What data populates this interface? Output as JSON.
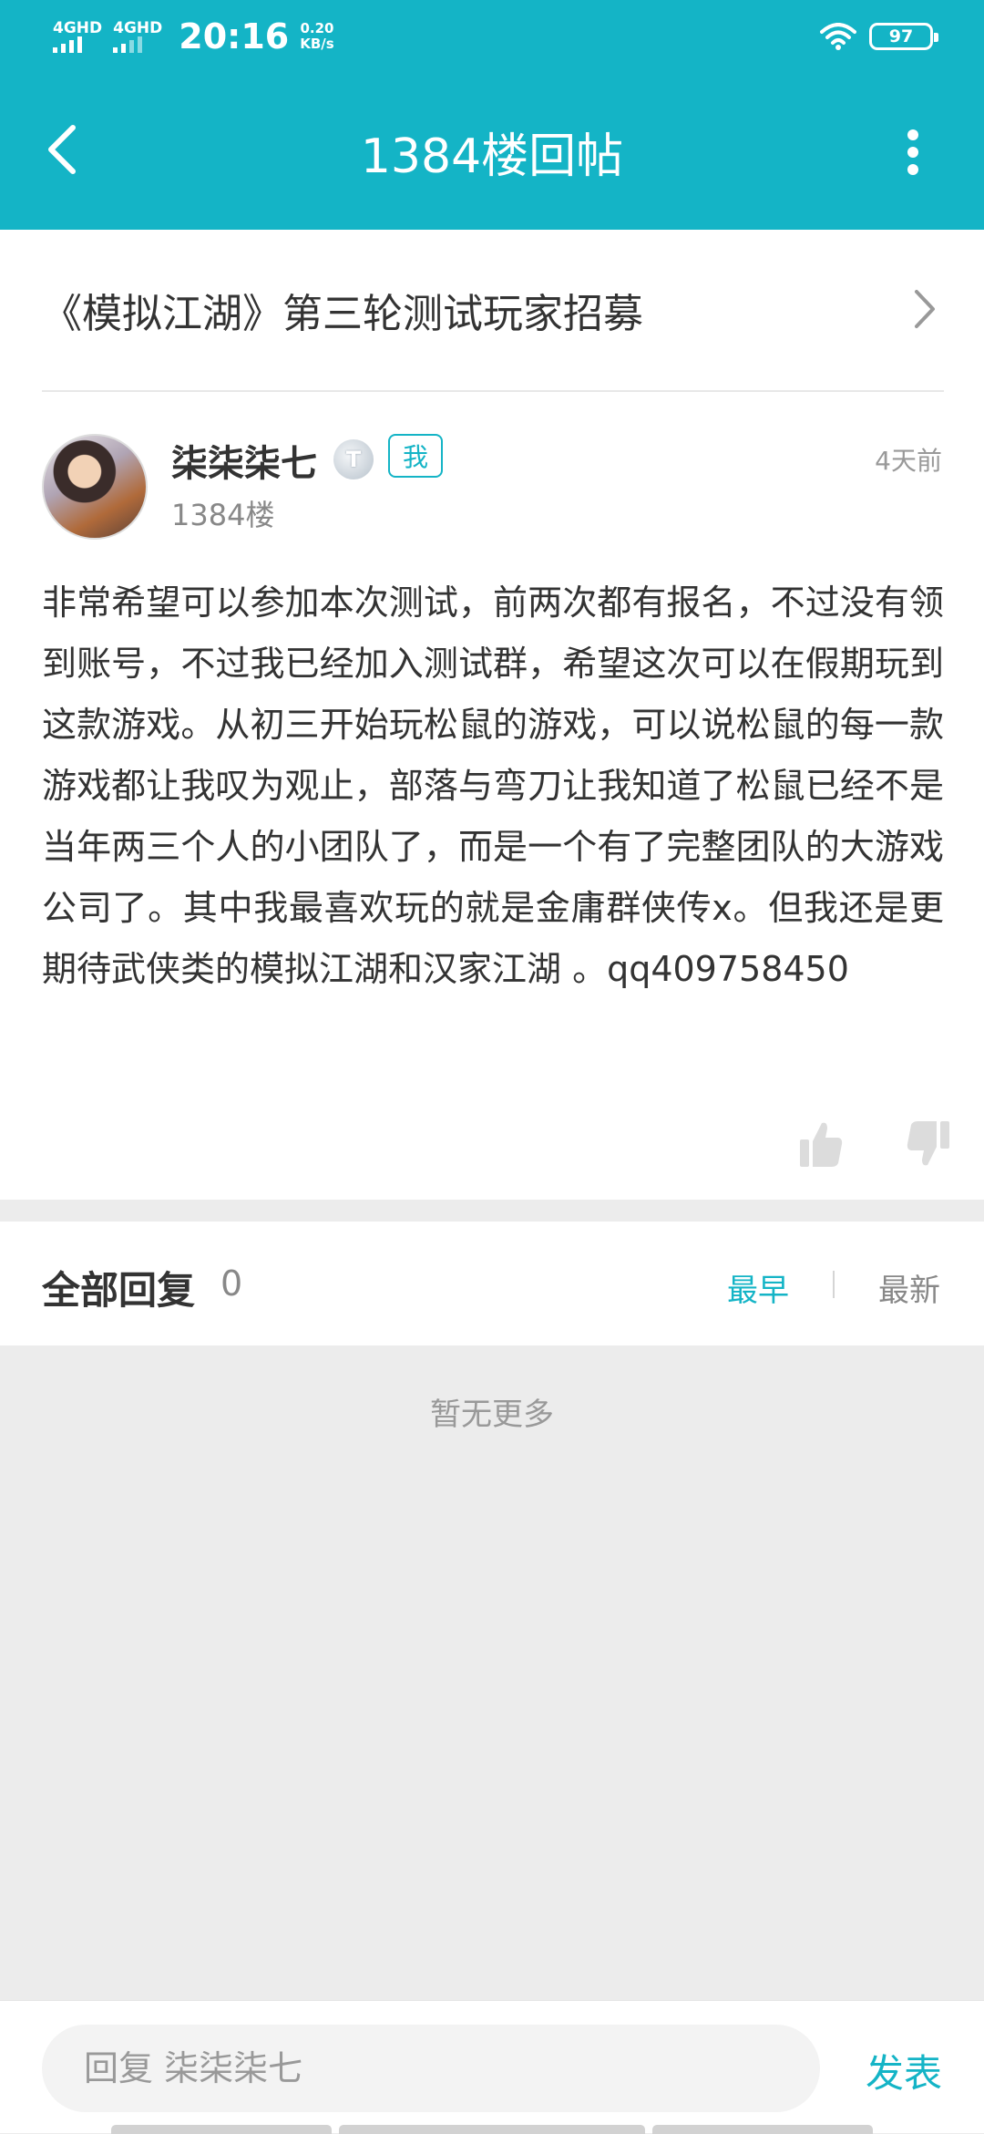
{
  "status_bar": {
    "network_1": "4GHD",
    "network_2": "4GHD",
    "time": "20:16",
    "speed_value": "0.20",
    "speed_unit": "KB/s",
    "battery": "97"
  },
  "header": {
    "title": "1384楼回帖"
  },
  "topic": {
    "title": "《模拟江湖》第三轮测试玩家招募"
  },
  "post": {
    "author": "柒柒柒七",
    "level_badge": "T",
    "me_tag": "我",
    "time": "4天前",
    "floor": "1384楼",
    "content": " 非常希望可以参加本次测试，前两次都有报名，不过没有领到账号，不过我已经加入测试群，希望这次可以在假期玩到这款游戏。从初三开始玩松鼠的游戏，可以说松鼠的每一款游戏都让我叹为观止，部落与弯刀让我知道了松鼠已经不是当年两三个人的小团队了，而是一个有了完整团队的大游戏公司了。其中我最喜欢玩的就是金庸群侠传x。但我还是更期待武侠类的模拟江湖和汉家江湖 。qq409758450"
  },
  "replies": {
    "title": "全部回复",
    "count": "0",
    "sort_earliest": "最早",
    "sort_newest": "最新",
    "empty_text": "暂无更多"
  },
  "reply_bar": {
    "placeholder": "回复 柒柒柒七",
    "send_label": "发表"
  },
  "colors": {
    "accent": "#14b4c6",
    "background": "#ececec"
  },
  "icons": {
    "back": "chevron-left-icon",
    "more": "more-vertical-icon",
    "topic_arrow": "chevron-right-icon",
    "like": "thumbs-up-icon",
    "dislike": "thumbs-down-icon",
    "wifi": "wifi-icon"
  }
}
